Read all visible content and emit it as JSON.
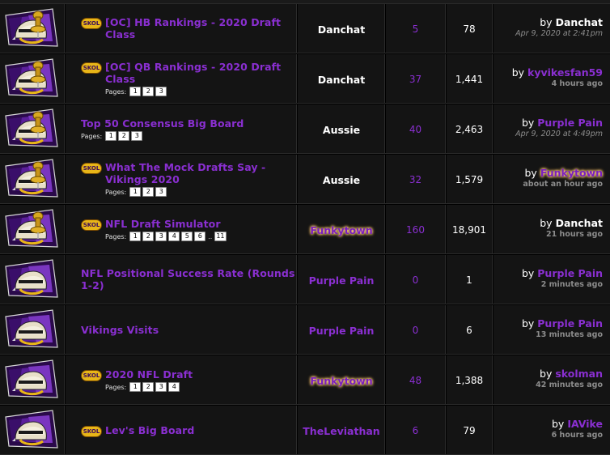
{
  "threads": [
    {
      "icon": "pinned-helmet-icon",
      "prefix": "SKOL",
      "title_lines": [
        "[OC] HB Rankings - 2020 Draft",
        "Class"
      ],
      "pages_label": "",
      "pages": [],
      "author": "Danchat",
      "author_style": "white",
      "replies": "5",
      "views": "78",
      "last_by": "by",
      "last_user": "Danchat",
      "last_user_style": "white",
      "last_time": "Apr 9, 2020 at 2:41pm",
      "last_time_style": "italic"
    },
    {
      "icon": "pinned-helmet-icon",
      "prefix": "SKOL",
      "title_lines": [
        "[OC] QB Rankings - 2020 Draft",
        "Class"
      ],
      "pages_label": "Pages:",
      "pages": [
        "1",
        "2",
        "3"
      ],
      "author": "Danchat",
      "author_style": "white",
      "replies": "37",
      "views": "1,441",
      "last_by": "by",
      "last_user": "kyvikesfan59",
      "last_user_style": "purple",
      "last_time": "4 hours ago",
      "last_time_style": "bold"
    },
    {
      "icon": "pinned-helmet-icon",
      "prefix": "",
      "title_lines": [
        "Top 50 Consensus Big Board"
      ],
      "pages_label": "Pages:",
      "pages": [
        "1",
        "2",
        "3"
      ],
      "author": "Aussie",
      "author_style": "white",
      "replies": "40",
      "views": "2,463",
      "last_by": "by",
      "last_user": "Purple Pain",
      "last_user_style": "purple",
      "last_time": "Apr 9, 2020 at 4:49pm",
      "last_time_style": "italic"
    },
    {
      "icon": "pinned-helmet-icon",
      "prefix": "SKOL",
      "title_lines": [
        "What The Mock Drafts Say -",
        "Vikings 2020"
      ],
      "pages_label": "Pages:",
      "pages": [
        "1",
        "2",
        "3"
      ],
      "author": "Aussie",
      "author_style": "white",
      "replies": "32",
      "views": "1,579",
      "last_by": "by",
      "last_user": "Funkytown",
      "last_user_style": "glow",
      "last_time": "about an hour ago",
      "last_time_style": "bold"
    },
    {
      "icon": "pinned-helmet-icon",
      "prefix": "SKOL",
      "title_lines": [
        "NFL Draft Simulator"
      ],
      "pages_label": "Pages:",
      "pages": [
        "1",
        "2",
        "3",
        "4",
        "5",
        "6",
        "..",
        "11"
      ],
      "author": "Funkytown",
      "author_style": "glow",
      "replies": "160",
      "views": "18,901",
      "last_by": "by",
      "last_user": "Danchat",
      "last_user_style": "white",
      "last_time": "21 hours ago",
      "last_time_style": "bold"
    },
    {
      "icon": "helmet-icon",
      "prefix": "",
      "title_lines": [
        "NFL Positional Success Rate (Rounds",
        "1-2)"
      ],
      "pages_label": "",
      "pages": [],
      "author": "Purple Pain",
      "author_style": "purple",
      "replies": "0",
      "views": "1",
      "last_by": "by",
      "last_user": "Purple Pain",
      "last_user_style": "purple",
      "last_time": "2 minutes ago",
      "last_time_style": "bold"
    },
    {
      "icon": "helmet-icon",
      "prefix": "",
      "title_lines": [
        "Vikings Visits"
      ],
      "pages_label": "",
      "pages": [],
      "author": "Purple Pain",
      "author_style": "purple",
      "replies": "0",
      "views": "6",
      "last_by": "by",
      "last_user": "Purple Pain",
      "last_user_style": "purple",
      "last_time": "13 minutes ago",
      "last_time_style": "bold"
    },
    {
      "icon": "helmet-icon",
      "prefix": "SKOL",
      "title_lines": [
        "2020 NFL Draft"
      ],
      "pages_label": "Pages:",
      "pages": [
        "1",
        "2",
        "3",
        "4"
      ],
      "author": "Funkytown",
      "author_style": "glow",
      "replies": "48",
      "views": "1,388",
      "last_by": "by",
      "last_user": "skolman",
      "last_user_style": "purple",
      "last_time": "42 minutes ago",
      "last_time_style": "bold"
    },
    {
      "icon": "helmet-icon",
      "prefix": "SKOL",
      "title_lines": [
        "Lev's Big Board"
      ],
      "pages_label": "",
      "pages": [],
      "author": "TheLeviathan",
      "author_style": "purple",
      "replies": "6",
      "views": "79",
      "last_by": "by",
      "last_user": "IAVike",
      "last_user_style": "purple",
      "last_time": "6 hours ago",
      "last_time_style": "bold"
    }
  ],
  "colors": {
    "link_purple": "#8a2fd1",
    "prefix_gold": "#e8b618",
    "cell_bg": "#141414",
    "time_gray": "#8c8c8c"
  }
}
